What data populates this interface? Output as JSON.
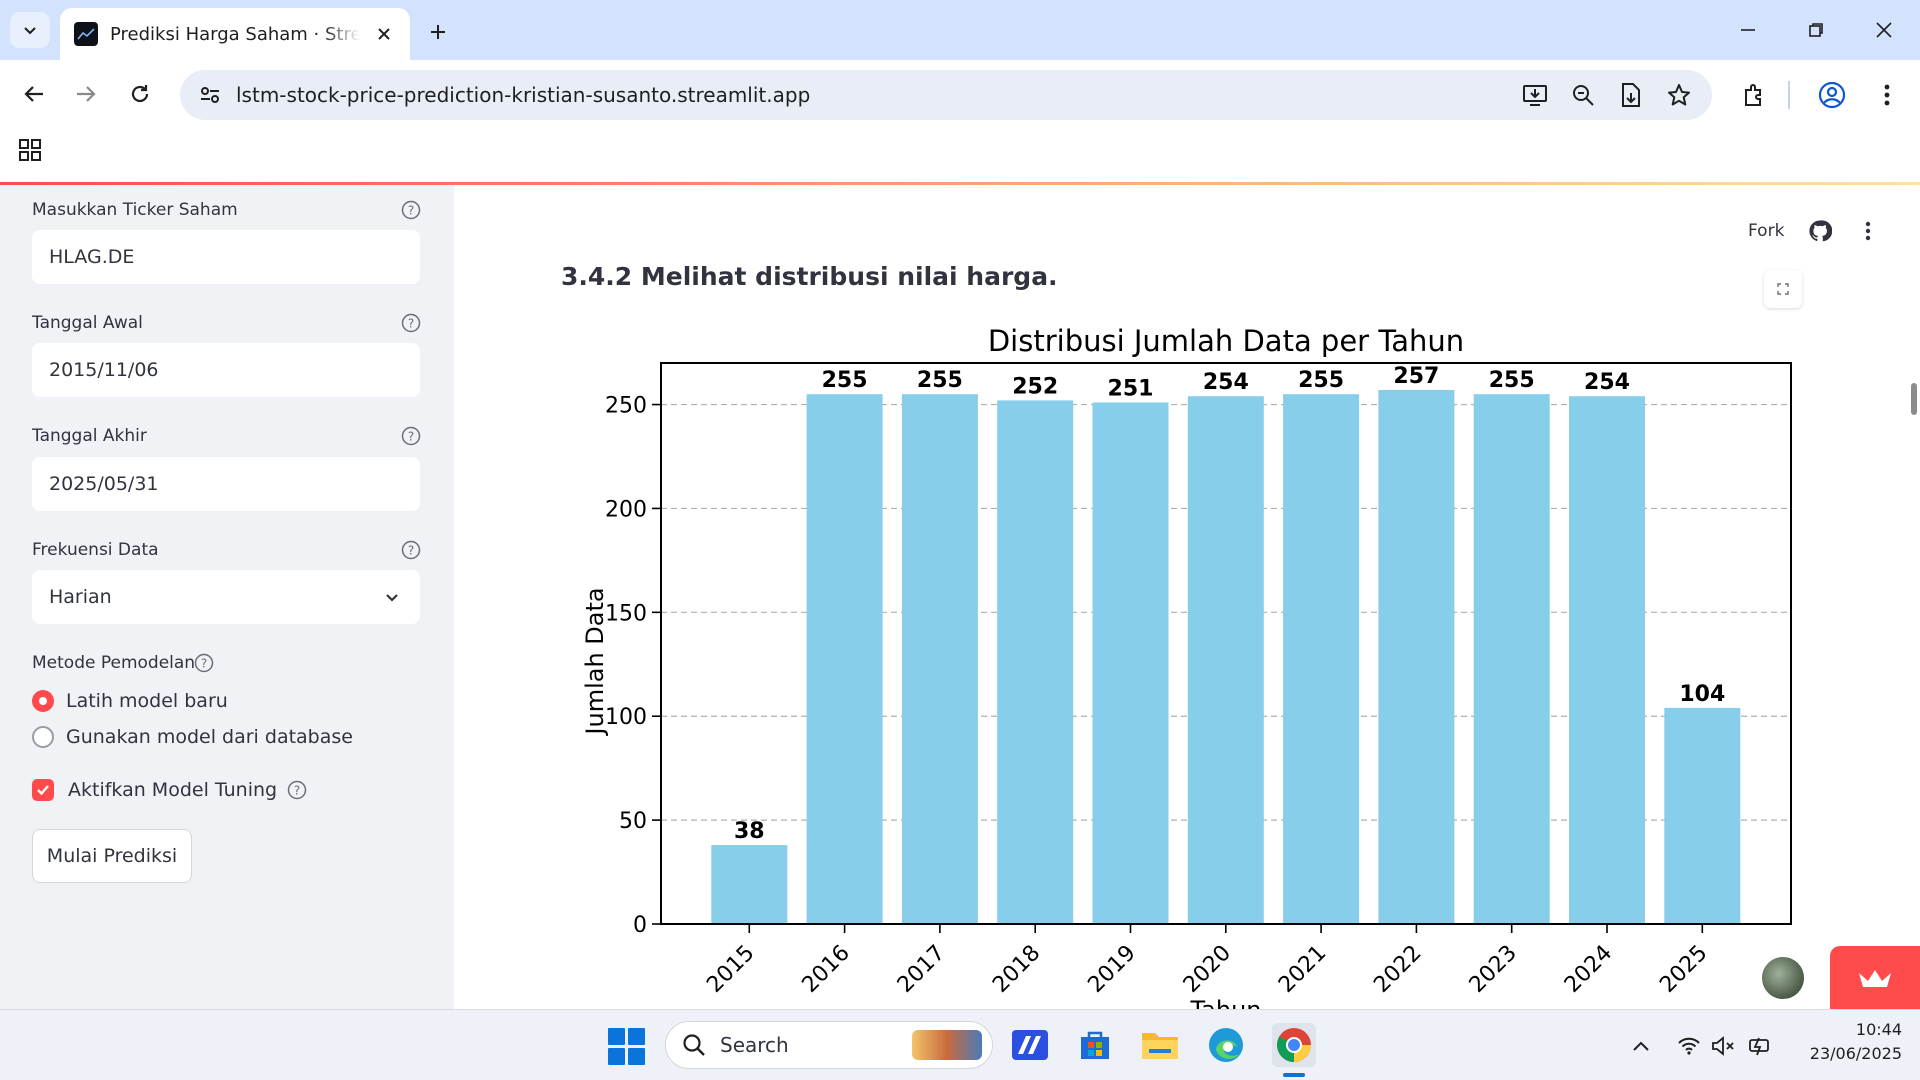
{
  "browser": {
    "tab_title": "Prediksi Harga Saham · Streamlit",
    "url": "lstm-stock-price-prediction-kristian-susanto.streamlit.app"
  },
  "header": {
    "fork_label": "Fork"
  },
  "sidebar": {
    "ticker": {
      "label": "Masukkan Ticker Saham",
      "value": "HLAG.DE"
    },
    "start_date": {
      "label": "Tanggal Awal",
      "value": "2015/11/06"
    },
    "end_date": {
      "label": "Tanggal Akhir",
      "value": "2025/05/31"
    },
    "frequency": {
      "label": "Frekuensi Data",
      "value": "Harian"
    },
    "method": {
      "label": "Metode Pemodelan",
      "options": [
        "Latih model baru",
        "Gunakan model dari database"
      ],
      "selected": "Latih model baru"
    },
    "tuning": {
      "label": "Aktifkan Model Tuning",
      "checked": true
    },
    "run_button": "Mulai Prediksi"
  },
  "main": {
    "section_heading": "3.4.2 Melihat distribusi nilai harga."
  },
  "chart_data": {
    "type": "bar",
    "title": "Distribusi Jumlah Data per Tahun",
    "xlabel": "Tahun",
    "ylabel": "Jumlah Data",
    "categories": [
      "2015",
      "2016",
      "2017",
      "2018",
      "2019",
      "2020",
      "2021",
      "2022",
      "2023",
      "2024",
      "2025"
    ],
    "values": [
      38,
      255,
      255,
      252,
      251,
      254,
      255,
      257,
      255,
      254,
      104
    ],
    "data_labels": [
      "38",
      "255",
      "255",
      "252",
      "251",
      "254",
      "255",
      "257",
      "255",
      "254",
      "104"
    ],
    "ylim": [
      0,
      270
    ],
    "yticks": [
      0,
      50,
      100,
      150,
      200,
      250
    ],
    "ytick_labels": [
      "0",
      "50",
      "100",
      "150",
      "200",
      "250"
    ],
    "grid": "horizontal dashed",
    "bar_color": "#87ceeb"
  },
  "taskbar": {
    "search_placeholder": "Search",
    "time": "10:44",
    "date": "23/06/2025"
  },
  "colors": {
    "accent": "#ff4b4b",
    "sidebar_bg": "#f0f2f6",
    "tabstrip_bg": "#d3e3fd"
  }
}
